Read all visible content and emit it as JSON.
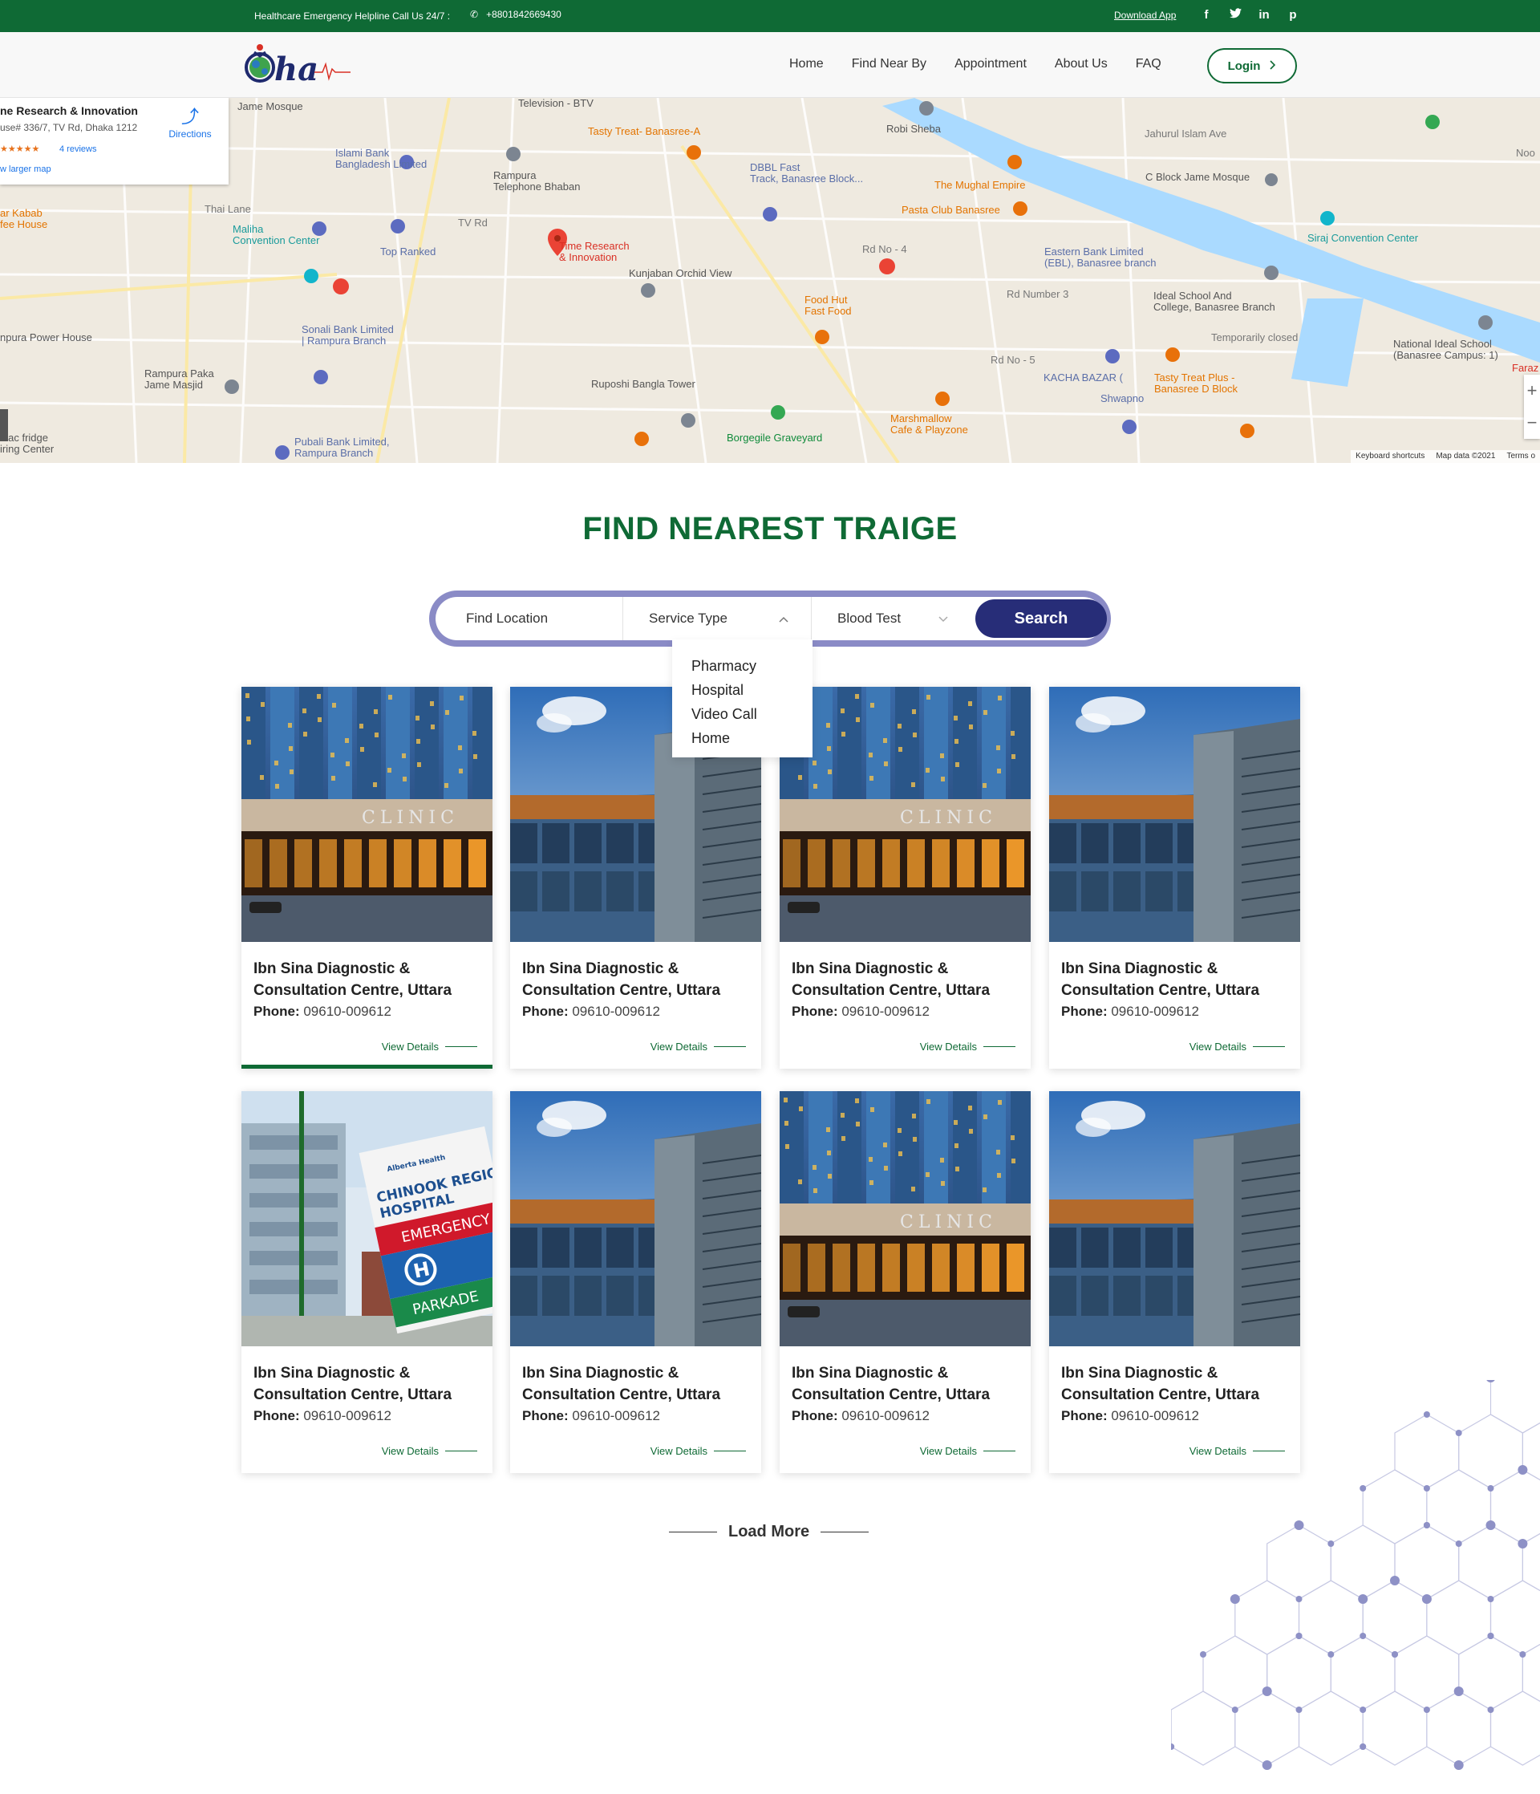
{
  "topbar": {
    "helpline": "Healthcare Emergency Helpline Call Us 24/7 :",
    "phone": "+8801842669430",
    "download": "Download App",
    "socials": [
      "f",
      "t",
      "in",
      "p"
    ]
  },
  "header": {
    "nav": [
      "Home",
      "Find Near By",
      "Appointment",
      "About Us",
      "FAQ"
    ],
    "login": "Login"
  },
  "map": {
    "card": {
      "title": "ne Research & Innovation",
      "address": "use# 336/7, TV Rd, Dhaka 1212",
      "stars": "★★★★★",
      "reviews": "4 reviews",
      "larger": "w larger map",
      "directions": "Directions"
    },
    "footer": [
      "Keyboard shortcuts",
      "Map data ©2021",
      "Terms o"
    ],
    "labels": [
      {
        "text": "Time Research\n& Innovation",
        "color": "#d93025"
      },
      {
        "text": "Islami Bank\nBangladesh Limited",
        "color": "#5a6ea8"
      },
      {
        "text": "Rampura\nTelephone Bhaban",
        "color": "#555"
      },
      {
        "text": "Tasty Treat- Banasree-A",
        "color": "#e37400"
      },
      {
        "text": "DBBL Fast\nTrack, Banasree Block...",
        "color": "#5a6ea8"
      },
      {
        "text": "Robi Sheba",
        "color": "#555"
      },
      {
        "text": "The Mughal Empire",
        "color": "#e37400"
      },
      {
        "text": "Pasta Club Banasree",
        "color": "#e37400"
      },
      {
        "text": "C Block Jame Mosque",
        "color": "#555"
      },
      {
        "text": "Siraj Convention Center",
        "color": "#1a9b9b"
      },
      {
        "text": "Maliha\nConvention Center",
        "color": "#1a9b9b"
      },
      {
        "text": "Top Ranked",
        "color": "#5a6ea8"
      },
      {
        "text": "Kunjaban Orchid View",
        "color": "#555"
      },
      {
        "text": "Eastern Bank Limited\n(EBL), Banasree branch",
        "color": "#5a6ea8"
      },
      {
        "text": "Ideal School And\nCollege, Banasree Branch",
        "color": "#555"
      },
      {
        "text": "Temporarily closed",
        "color": "#777"
      },
      {
        "text": "National Ideal School\n(Banasree Campus: 1)",
        "color": "#555"
      },
      {
        "text": "Sonali Bank Limited\n| Rampura Branch",
        "color": "#5a6ea8"
      },
      {
        "text": "Food Hut\nFast Food",
        "color": "#e37400"
      },
      {
        "text": "KACHA BAZAR (",
        "color": "#5a6ea8"
      },
      {
        "text": "Tasty Treat Plus -\nBanasree D Block",
        "color": "#e37400"
      },
      {
        "text": "Shwapno",
        "color": "#5a6ea8"
      },
      {
        "text": "Rampura Paka\nJame Masjid",
        "color": "#555"
      },
      {
        "text": "Ruposhi Bangla Tower",
        "color": "#555"
      },
      {
        "text": "Marshmallow\nCafe & Playzone",
        "color": "#e37400"
      },
      {
        "text": "Borgegile Graveyard",
        "color": "#0f8a3a"
      },
      {
        "text": "Pubali Bank Limited,\nRampura Branch",
        "color": "#5a6ea8"
      },
      {
        "text": "ar Kabab\nfee House",
        "color": "#e37400"
      },
      {
        "text": "npura Power House",
        "color": "#555"
      },
      {
        "text": "s ac fridge\niring Center",
        "color": "#555"
      },
      {
        "text": "Faraz",
        "color": "#d93025"
      },
      {
        "text": "Television - BTV",
        "color": "#555"
      },
      {
        "text": "Jame Mosque",
        "color": "#555"
      },
      {
        "text": "Thai Lane",
        "color": "#777"
      },
      {
        "text": "TV Rd",
        "color": "#777"
      },
      {
        "text": "Rd No - 4",
        "color": "#777"
      },
      {
        "text": "Rd Number 3",
        "color": "#777"
      },
      {
        "text": "Rd No - 5",
        "color": "#777"
      },
      {
        "text": "Jahurul Islam Ave",
        "color": "#777"
      },
      {
        "text": "Noo",
        "color": "#777"
      }
    ]
  },
  "section_title": "FIND NEAREST  TRAIGE",
  "search": {
    "location": "Find Location",
    "service": "Service Type",
    "blood": "Blood Test",
    "button": "Search"
  },
  "dropdown": [
    "Pharmacy",
    "Hospital",
    "Video Call",
    "Home"
  ],
  "cards": [
    {
      "name": "Ibn Sina Diagnostic & Consultation Centre, Uttara",
      "phone_label": "Phone:",
      "phone": "09610-009612",
      "link": "View Details",
      "image": "clinic-night"
    },
    {
      "name": "Ibn Sina Diagnostic & Consultation Centre, Uttara",
      "phone_label": "Phone:",
      "phone": "09610-009612",
      "link": "View Details",
      "image": "glass-building"
    },
    {
      "name": "Ibn Sina Diagnostic & Consultation Centre, Uttara",
      "phone_label": "Phone:",
      "phone": "09610-009612",
      "link": "View Details",
      "image": "clinic-night"
    },
    {
      "name": "Ibn Sina Diagnostic & Consultation Centre, Uttara",
      "phone_label": "Phone:",
      "phone": "09610-009612",
      "link": "View Details",
      "image": "glass-building"
    },
    {
      "name": "Ibn Sina Diagnostic & Consultation Centre, Uttara",
      "phone_label": "Phone:",
      "phone": "09610-009612",
      "link": "View Details",
      "image": "hospital-sign"
    },
    {
      "name": "Ibn Sina Diagnostic & Consultation Centre, Uttara",
      "phone_label": "Phone:",
      "phone": "09610-009612",
      "link": "View Details",
      "image": "glass-building"
    },
    {
      "name": "Ibn Sina Diagnostic & Consultation Centre, Uttara",
      "phone_label": "Phone:",
      "phone": "09610-009612",
      "link": "View Details",
      "image": "clinic-night"
    },
    {
      "name": "Ibn Sina Diagnostic & Consultation Centre, Uttara",
      "phone_label": "Phone:",
      "phone": "09610-009612",
      "link": "View Details",
      "image": "glass-building"
    }
  ],
  "image_text": {
    "clinic_sign": "CLINIC",
    "hospital_sign": [
      "Alberta Health",
      "CHINOOK REGIONAL",
      "HOSPITAL",
      "EMERGENCY",
      "H",
      "PARKADE"
    ]
  },
  "load_more": "Load More",
  "colors": {
    "brand_green": "#0f6a35",
    "accent_navy": "#272d78",
    "search_ring": "#8a8bc6"
  }
}
